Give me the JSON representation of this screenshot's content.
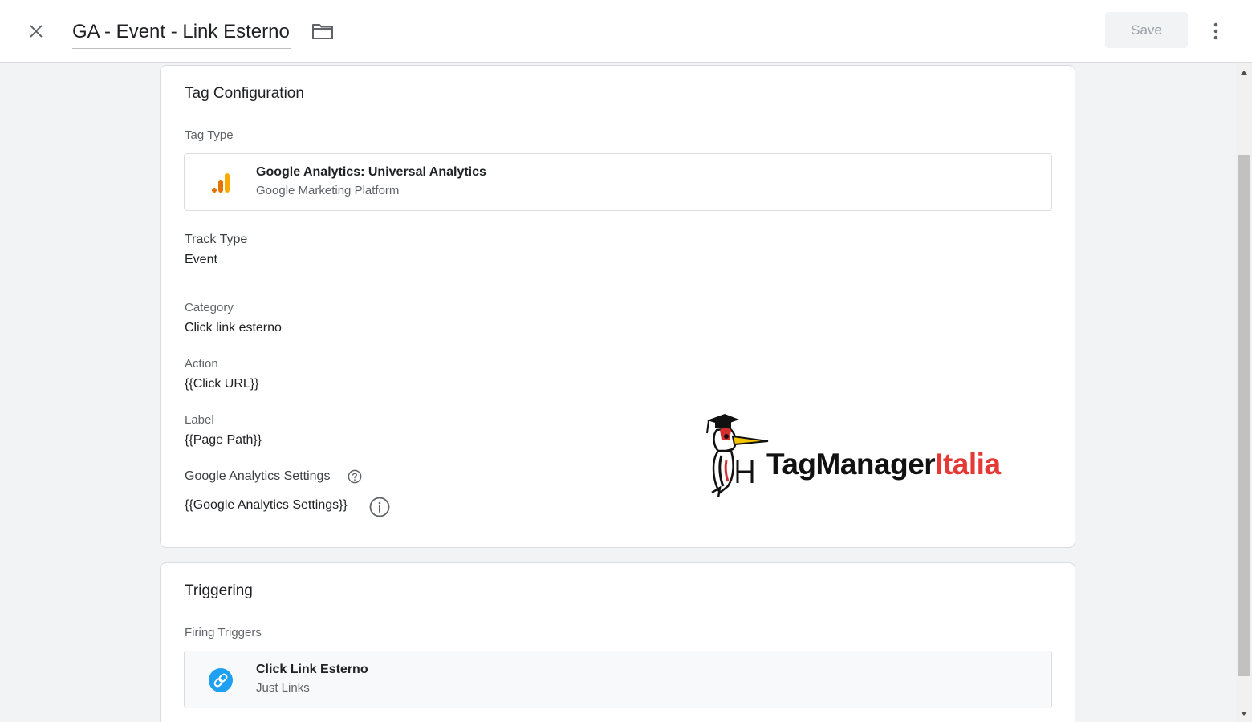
{
  "header": {
    "title": "GA - Event - Link Esterno",
    "save_label": "Save",
    "icons": [
      "close-icon",
      "folder-icon",
      "more-vert-icon"
    ]
  },
  "tag_config": {
    "title": "Tag Configuration",
    "tag_type_label": "Tag Type",
    "tag_type": {
      "name": "Google Analytics: Universal Analytics",
      "provider": "Google Marketing Platform",
      "icon": "google-analytics-icon"
    },
    "track_type_label": "Track Type",
    "track_type_value": "Event",
    "category_label": "Category",
    "category_value": "Click link esterno",
    "action_label": "Action",
    "action_value": "{{Click URL}}",
    "label_label": "Label",
    "label_value": "{{Page Path}}",
    "ga_settings_label": "Google Analytics Settings",
    "ga_settings_value": "{{Google Analytics Settings}}"
  },
  "triggering": {
    "title": "Triggering",
    "firing_label": "Firing Triggers",
    "trigger": {
      "name": "Click Link Esterno",
      "type": "Just Links",
      "icon": "link-icon"
    }
  },
  "watermark": {
    "part1": "TagManager",
    "part2": "Italia"
  },
  "colors": {
    "accent_link": "#1ea1f2",
    "ga_orange": "#f9ab00",
    "ga_dark_orange": "#e37400",
    "logo_red": "#e53935"
  }
}
